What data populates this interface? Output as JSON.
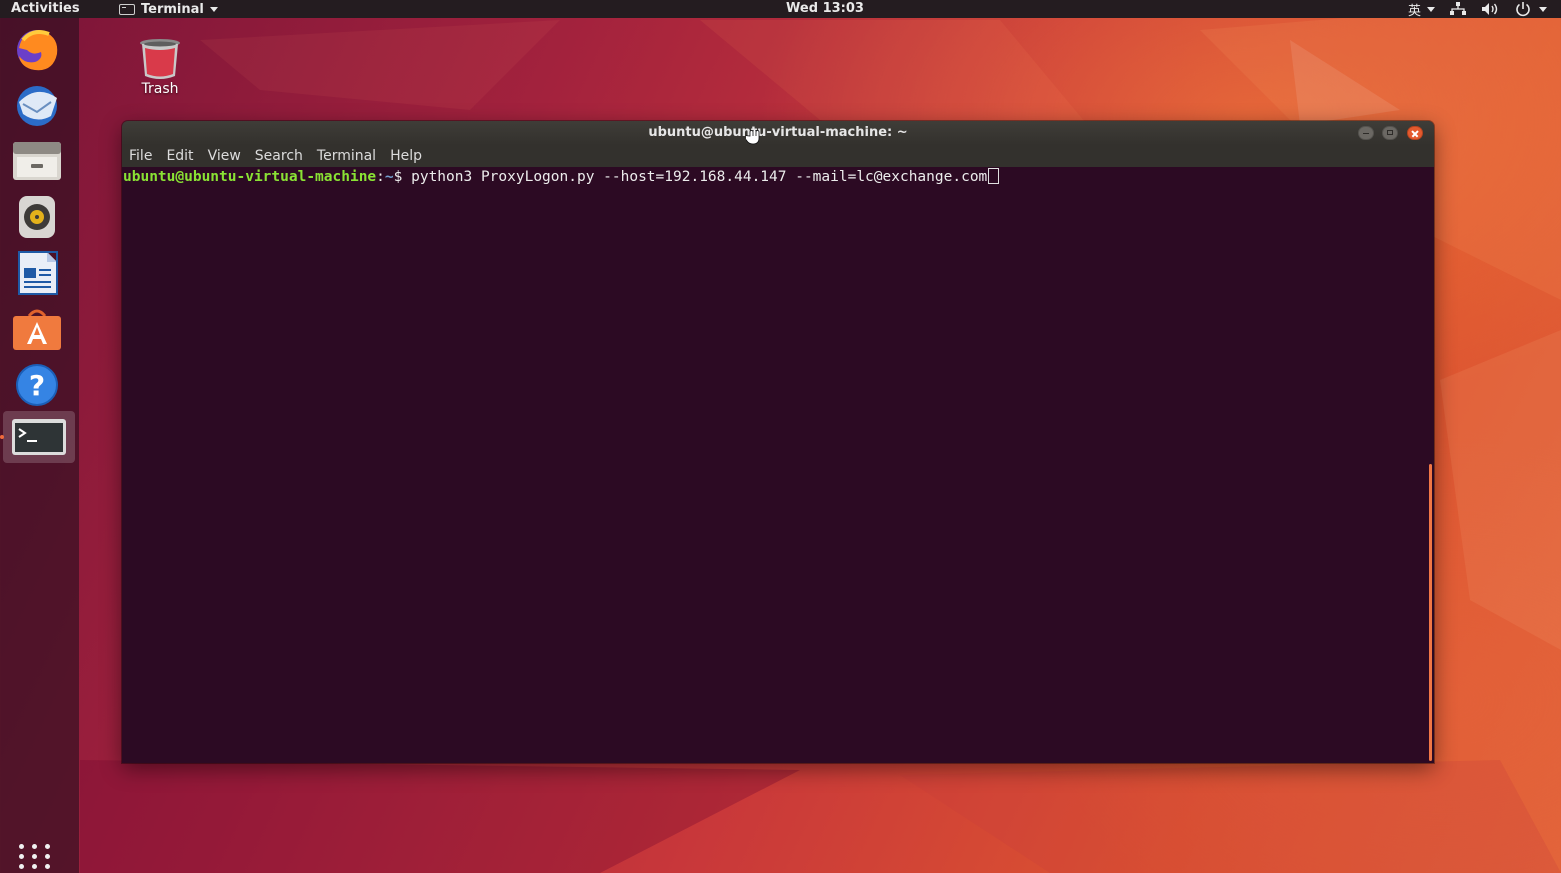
{
  "topbar": {
    "activities": "Activities",
    "app_name": "Terminal",
    "clock": "Wed 13:03",
    "input_method": "英",
    "icons": [
      "network-icon",
      "volume-icon",
      "power-icon"
    ]
  },
  "dock": {
    "apps": [
      {
        "name": "Firefox",
        "icon": "firefox-icon"
      },
      {
        "name": "Thunderbird",
        "icon": "thunderbird-icon"
      },
      {
        "name": "Files",
        "icon": "files-icon"
      },
      {
        "name": "Rhythmbox",
        "icon": "rhythmbox-icon"
      },
      {
        "name": "LibreOffice Writer",
        "icon": "writer-icon"
      },
      {
        "name": "Ubuntu Software",
        "icon": "software-icon"
      },
      {
        "name": "Help",
        "icon": "help-icon"
      },
      {
        "name": "Terminal",
        "icon": "terminal-icon",
        "active": true
      }
    ],
    "show_apps_icon": "app-grid-icon"
  },
  "desktop": {
    "trash_label": "Trash"
  },
  "terminal": {
    "title": "ubuntu@ubuntu-virtual-machine: ~",
    "menu": [
      "File",
      "Edit",
      "View",
      "Search",
      "Terminal",
      "Help"
    ],
    "prompt_user_host": "ubuntu@ubuntu-virtual-machine",
    "prompt_sep": ":",
    "prompt_path": "~",
    "prompt_symbol": "$ ",
    "command": "python3 ProxyLogon.py --host=192.168.44.147 --mail=lc@exchange.com"
  },
  "colors": {
    "topbar_bg": "#241c20",
    "terminal_bg": "#2c0a23",
    "prompt_green": "#8ae234",
    "prompt_blue": "#729fcf",
    "accent_orange": "#e45a2e"
  }
}
